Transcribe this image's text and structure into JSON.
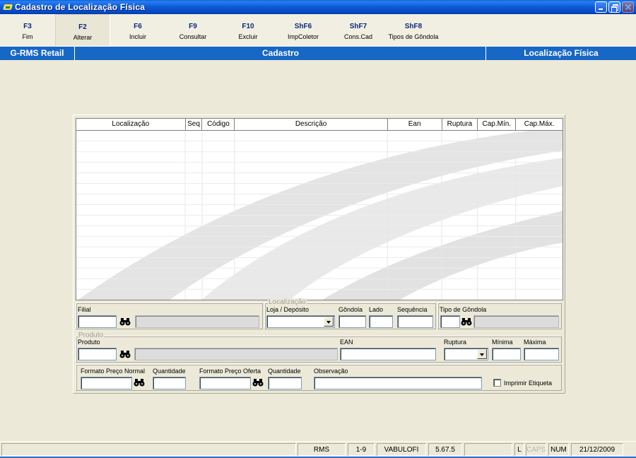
{
  "window": {
    "title": "Cadastro de Localização Física"
  },
  "toolbar": {
    "buttons": [
      {
        "key": "F3",
        "label": "Fim"
      },
      {
        "key": "F2",
        "label": "Alterar"
      },
      {
        "key": "F6",
        "label": "Incluir"
      },
      {
        "key": "F9",
        "label": "Consultar"
      },
      {
        "key": "F10",
        "label": "Excluir"
      },
      {
        "key": "ShF6",
        "label": "ImpColetor"
      },
      {
        "key": "ShF7",
        "label": "Cons.Cad"
      },
      {
        "key": "ShF8",
        "label": "Tipos de Gôndola"
      }
    ]
  },
  "band": {
    "left": "G-RMS Retail",
    "center": "Cadastro",
    "right": "Localização Física"
  },
  "grid": {
    "columns": [
      "Localização",
      "Seq",
      "Código",
      "Descrição",
      "Ean",
      "Ruptura",
      "Cap.Mín.",
      "Cap.Máx."
    ],
    "rows": []
  },
  "form": {
    "filial_label": "Filial",
    "localizacao_legend": "Localização",
    "loja_label": "Loja / Depósito",
    "gondola_label": "Gôndola",
    "lado_label": "Lado",
    "sequencia_label": "Sequência",
    "tipo_gondola_label": "Tipo de Gôndola",
    "produto_legend": "Produto",
    "produto_label": "Produto",
    "ean_label": "EAN",
    "ruptura_label": "Ruptura",
    "minima_label": "Mínima",
    "maxima_label": "Máxima",
    "formato_normal_label": "Formato Preço Normal",
    "quantidade_label": "Quantidade",
    "formato_oferta_label": "Formato Preço Oferta",
    "quantidade2_label": "Quantidade",
    "observacao_label": "Observação",
    "imprimir_label": "Imprimir Etiqueta"
  },
  "status": {
    "system": "RMS",
    "range": "1-9",
    "user": "VABULOFI",
    "version": "5.67.5",
    "l": "L",
    "caps": "CAPS",
    "num": "NUM",
    "date": "21/12/2009"
  },
  "icons": {
    "app": "app-icon",
    "find": "binoculars-icon"
  }
}
